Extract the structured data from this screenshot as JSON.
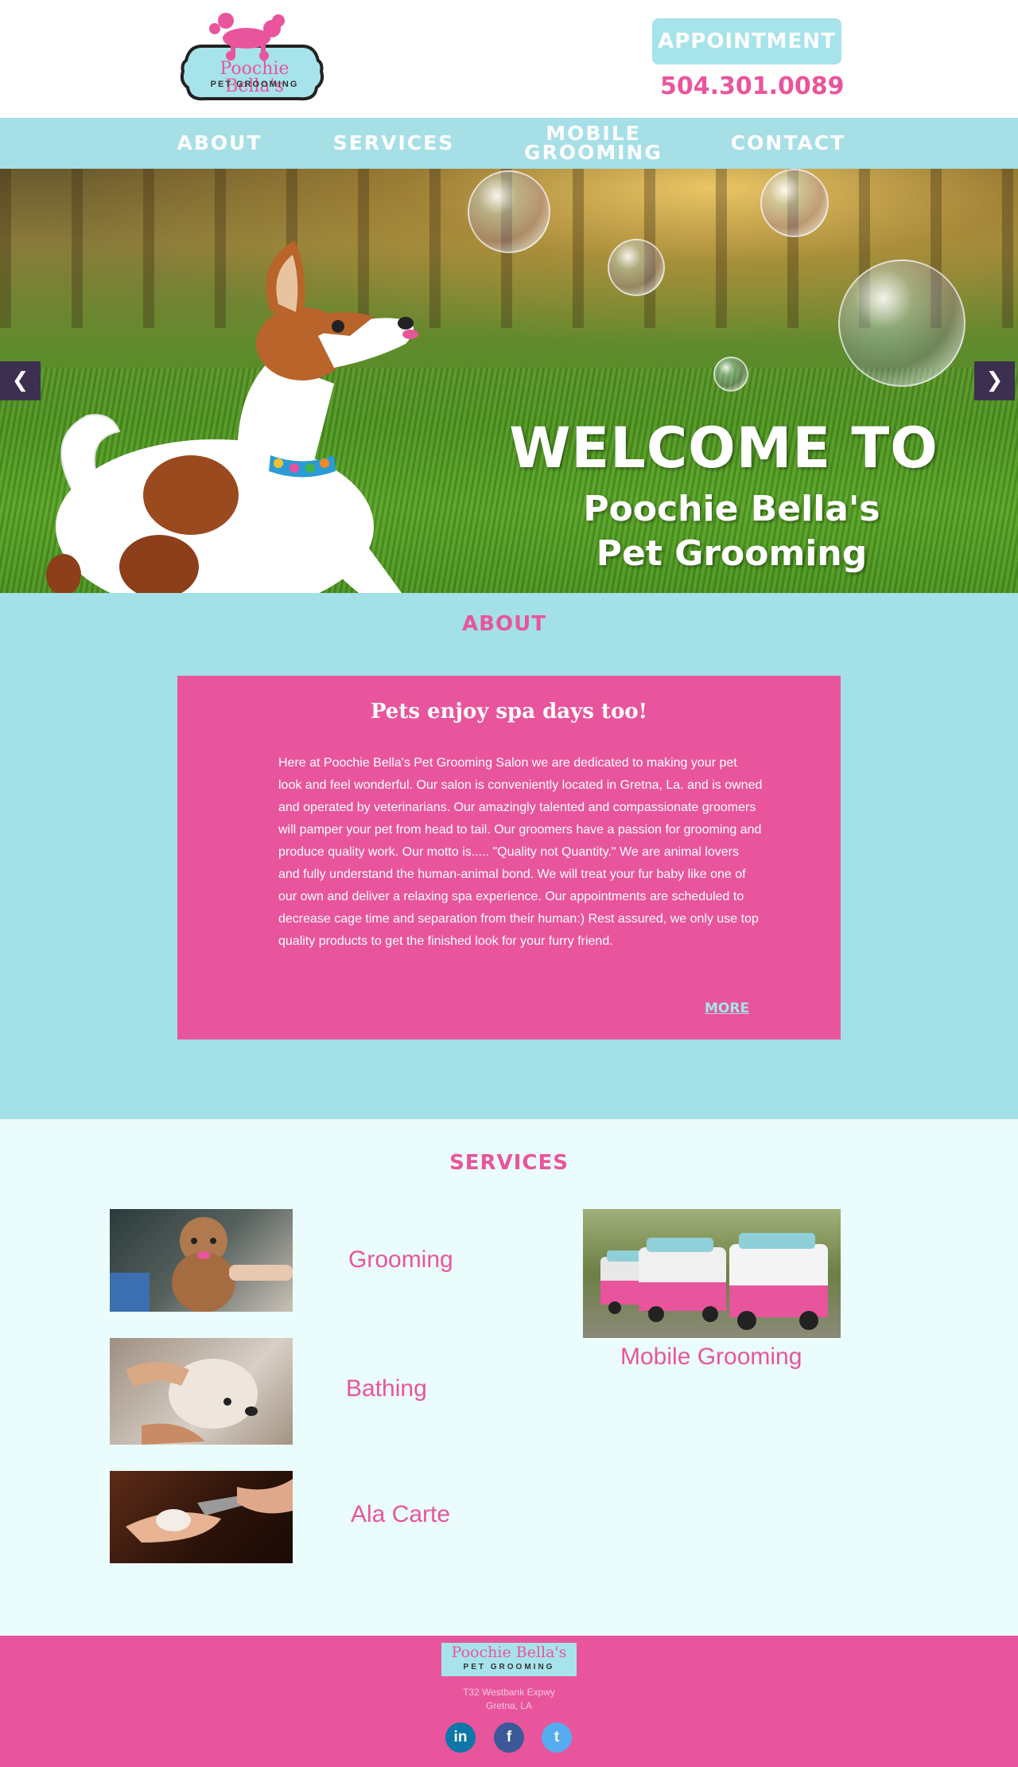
{
  "header": {
    "logo_text": "Poochie Bella's",
    "logo_sub": "PET GROOMING",
    "appointment_label": "APPOINTMENT",
    "phone": "504.301.0089"
  },
  "nav": {
    "items": [
      {
        "label": "ABOUT"
      },
      {
        "label": "SERVICES"
      },
      {
        "label": "MOBILE\nGROOMING"
      },
      {
        "label": "CONTACT"
      }
    ]
  },
  "hero": {
    "title": "WELCOME TO",
    "subtitle_line1": "Poochie Bella's",
    "subtitle_line2": "Pet Grooming",
    "prev_icon": "chevron-left-icon",
    "next_icon": "chevron-right-icon"
  },
  "about": {
    "section_title": "ABOUT",
    "heading": "Pets enjoy spa days too!",
    "body": "Here at Poochie Bella's Pet Grooming Salon we are dedicated to making your pet look and feel wonderful.  Our salon is conveniently located in Gretna, La. and is owned and operated by veterinarians. Our amazingly talented and compassionate groomers will pamper your pet from head to tail.  Our groomers have a passion for grooming and produce quality work.  Our motto is..... \"Quality not Quantity.\"  We are animal lovers and fully understand the human-animal bond.  We will treat your fur baby like one of our own and deliver a relaxing spa experience.  Our appointments are scheduled to decrease cage time and separation from their human:)  Rest assured, we only use top quality products to get the finished look for your furry friend.",
    "more_label": "MORE"
  },
  "services": {
    "section_title": "SERVICES",
    "items": [
      {
        "label": "Grooming"
      },
      {
        "label": "Bathing"
      },
      {
        "label": "Ala Carte"
      },
      {
        "label": "Mobile Grooming"
      }
    ]
  },
  "footer": {
    "logo_text": "Poochie Bella's",
    "logo_sub": "PET GROOMING",
    "address_line1": "T32 Westbank Expwy",
    "address_line2": "Gretna, LA",
    "social": [
      {
        "name": "linkedin-icon",
        "glyph": "in"
      },
      {
        "name": "facebook-icon",
        "glyph": "f"
      },
      {
        "name": "twitter-icon",
        "glyph": "t"
      }
    ]
  },
  "colors": {
    "brand_pink": "#e8559c",
    "brand_aqua": "#a7e3eb",
    "about_bg": "#a3e0e7",
    "services_bg": "#eafcfb",
    "slider_arrow_bg": "#3d2f4f"
  }
}
